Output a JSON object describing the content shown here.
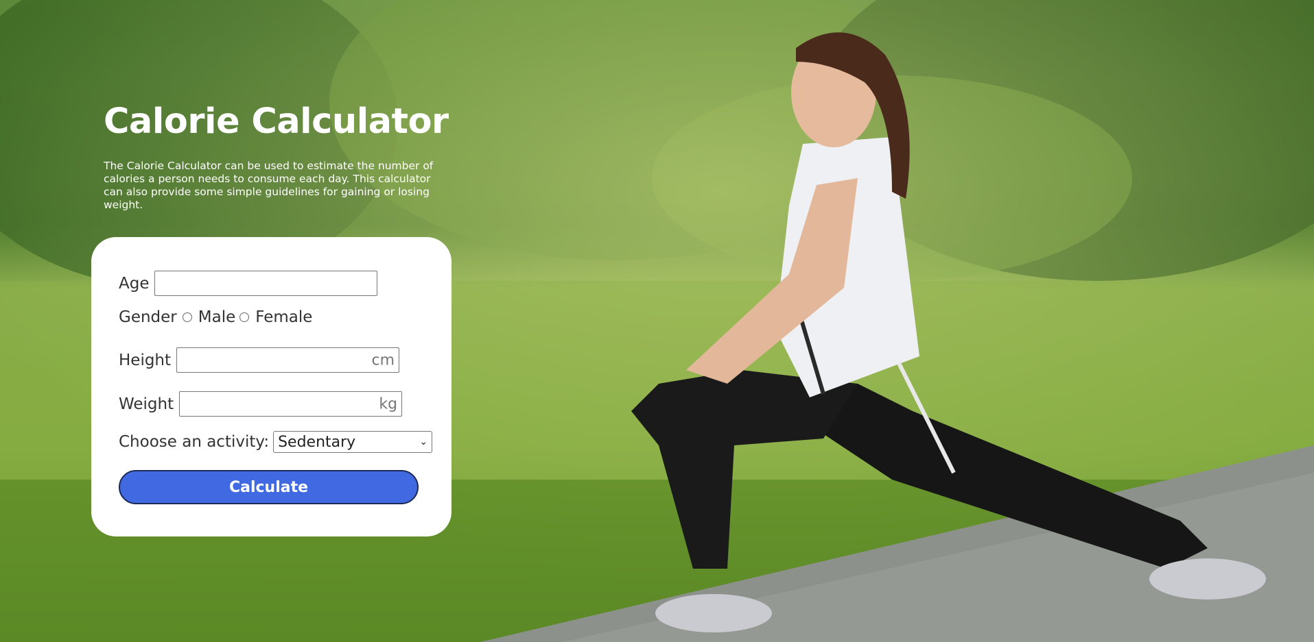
{
  "hero": {
    "title": "Calorie Calculator",
    "description": "The Calorie Calculator can be used to estimate the number of calories a person needs to consume each day. This calculator can also provide some simple guidelines for gaining or losing weight."
  },
  "form": {
    "age_label": "Age",
    "gender_label": "Gender",
    "gender_options": [
      "Male",
      "Female"
    ],
    "height_label": "Height",
    "height_unit": "cm",
    "weight_label": "Weight",
    "weight_unit": "kg",
    "activity_label": "Choose an activity:",
    "activity_selected": "Sedentary",
    "submit_label": "Calculate"
  },
  "colors": {
    "button": "#4169e1",
    "card": "#ffffff"
  }
}
